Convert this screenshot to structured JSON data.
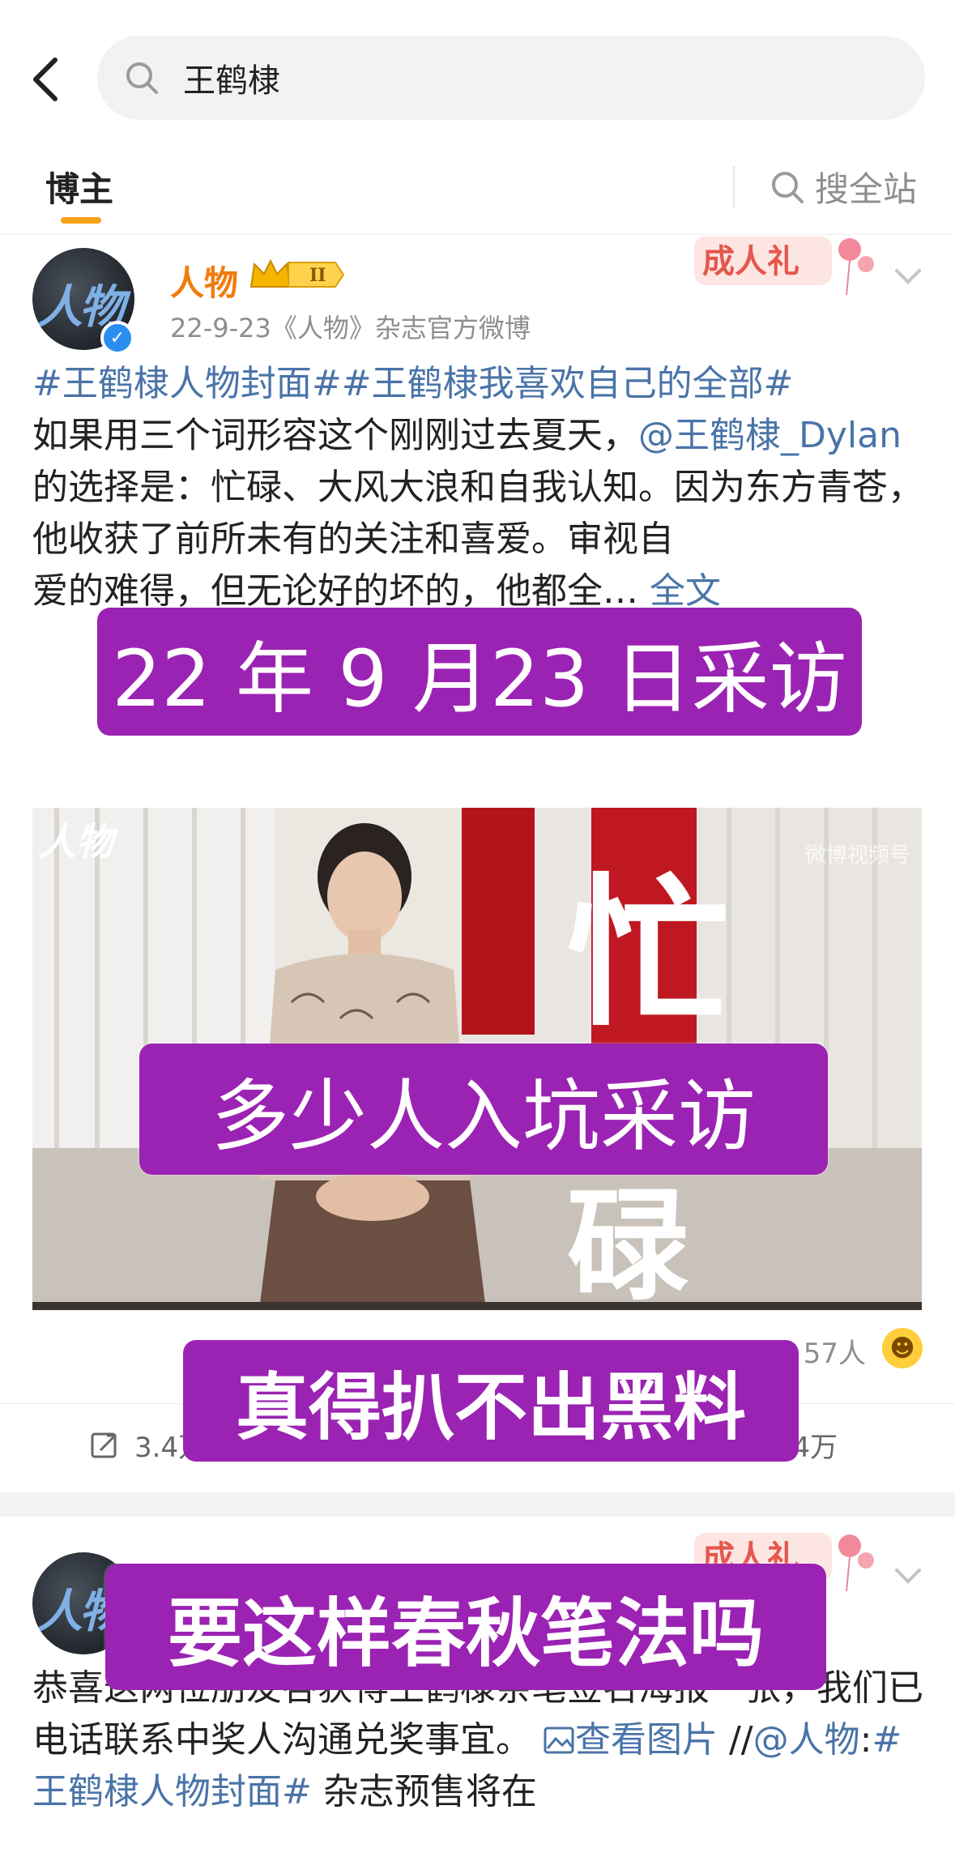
{
  "search": {
    "query": "王鹤棣",
    "search_icon": "search-icon",
    "back_icon": "back-chevron-icon"
  },
  "tabs": {
    "active": "博主",
    "search_all": "搜全站"
  },
  "post1": {
    "username": "人物",
    "avatar_text": "人物",
    "badge": "II",
    "meta": "22-9-23《人物》杂志官方微博",
    "decoration": "成人礼",
    "text_parts": {
      "t1": "#王鹤棣人物封面##王鹤棣我喜欢自己的全部#",
      "t2": "如果用三个词形容这个刚刚过去夏天，",
      "t3": "@王鹤棣_Dylan",
      "t4": " 的选择是：忙碌、大风大浪和自我认知。因为东方青苍，他收获了前所未有的关注和喜爱。",
      "t5": "审视自",
      "t6": "爱的难得，但无论好的坏的，他都全…",
      "t7": " 全文"
    },
    "video": {
      "watermark": "人物",
      "source": "微博视频号",
      "big_char_1": "忙",
      "big_char_2": "碌"
    },
    "likes": {
      "count_text": "57人"
    },
    "actions": {
      "repost": "3.4万",
      "comment": "",
      "like": "1.4万"
    }
  },
  "post2": {
    "avatar_text": "人物",
    "decoration": "成人礼",
    "text_parts": {
      "t1": "恭喜这两位朋友各获得王鹤棣亲笔签名海报一张，我们已电话联系中奖人沟通兑奖事宜。",
      "t2": "查看图片",
      "t3": " //",
      "t4": "@人物",
      "t5": ":",
      "t6": "#王鹤棣人物封面#",
      "t7": " 杂志预售将在"
    }
  },
  "captions": {
    "c1": "22 年 9 月23 日采访",
    "c2": "多少人入坑采访",
    "c3": "真得扒不出黑料",
    "c4": "要这样春秋笔法吗"
  },
  "colors": {
    "accent_orange": "#f7a21b",
    "link_blue": "#4a74a8",
    "caption_purple": "#9b23b3",
    "username_orange": "#f27b0d"
  }
}
